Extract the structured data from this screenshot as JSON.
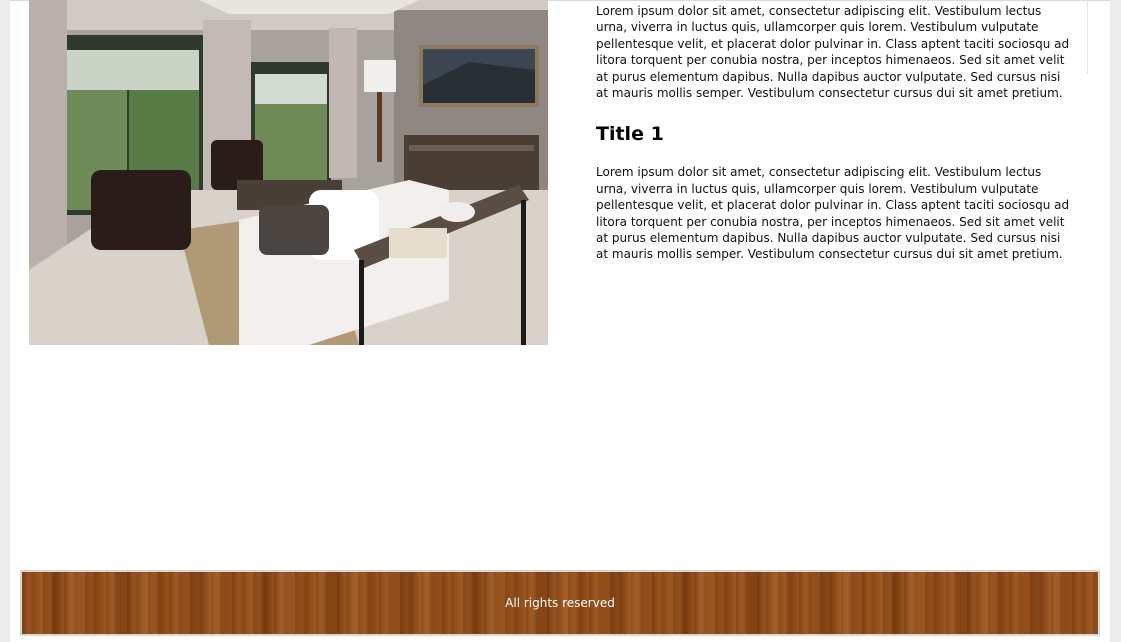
{
  "main": {
    "photo_alt": "Living room interior",
    "paragraph_1": "Lorem ipsum dolor sit amet, consectetur adipiscing elit. Vestibulum lectus urna, viverra in luctus quis, ullamcorper quis lorem. Vestibulum vulputate pellentesque velit, et placerat dolor pulvinar in. Class aptent taciti sociosqu ad litora torquent per conubia nostra, per inceptos himenaeos. Sed sit amet velit at purus elementum dapibus. Nulla dapibus auctor vulputate. Sed cursus nisi at mauris mollis semper. Vestibulum consectetur cursus dui sit amet pretium.",
    "title": "Title 1",
    "paragraph_2": "Lorem ipsum dolor sit amet, consectetur adipiscing elit. Vestibulum lectus urna, viverra in luctus quis, ullamcorper quis lorem. Vestibulum vulputate pellentesque velit, et placerat dolor pulvinar in. Class aptent taciti sociosqu ad litora torquent per conubia nostra, per inceptos himenaeos. Sed sit amet velit at purus elementum dapibus. Nulla dapibus auctor vulputate. Sed cursus nisi at mauris mollis semper. Vestibulum consectetur cursus dui sit amet pretium."
  },
  "footer": {
    "text": "All rights reserved"
  },
  "colors": {
    "page_bg": "#ececec",
    "content_bg": "#ffffff",
    "footer_wood": "#8b4511",
    "footer_text": "#ffffff"
  }
}
